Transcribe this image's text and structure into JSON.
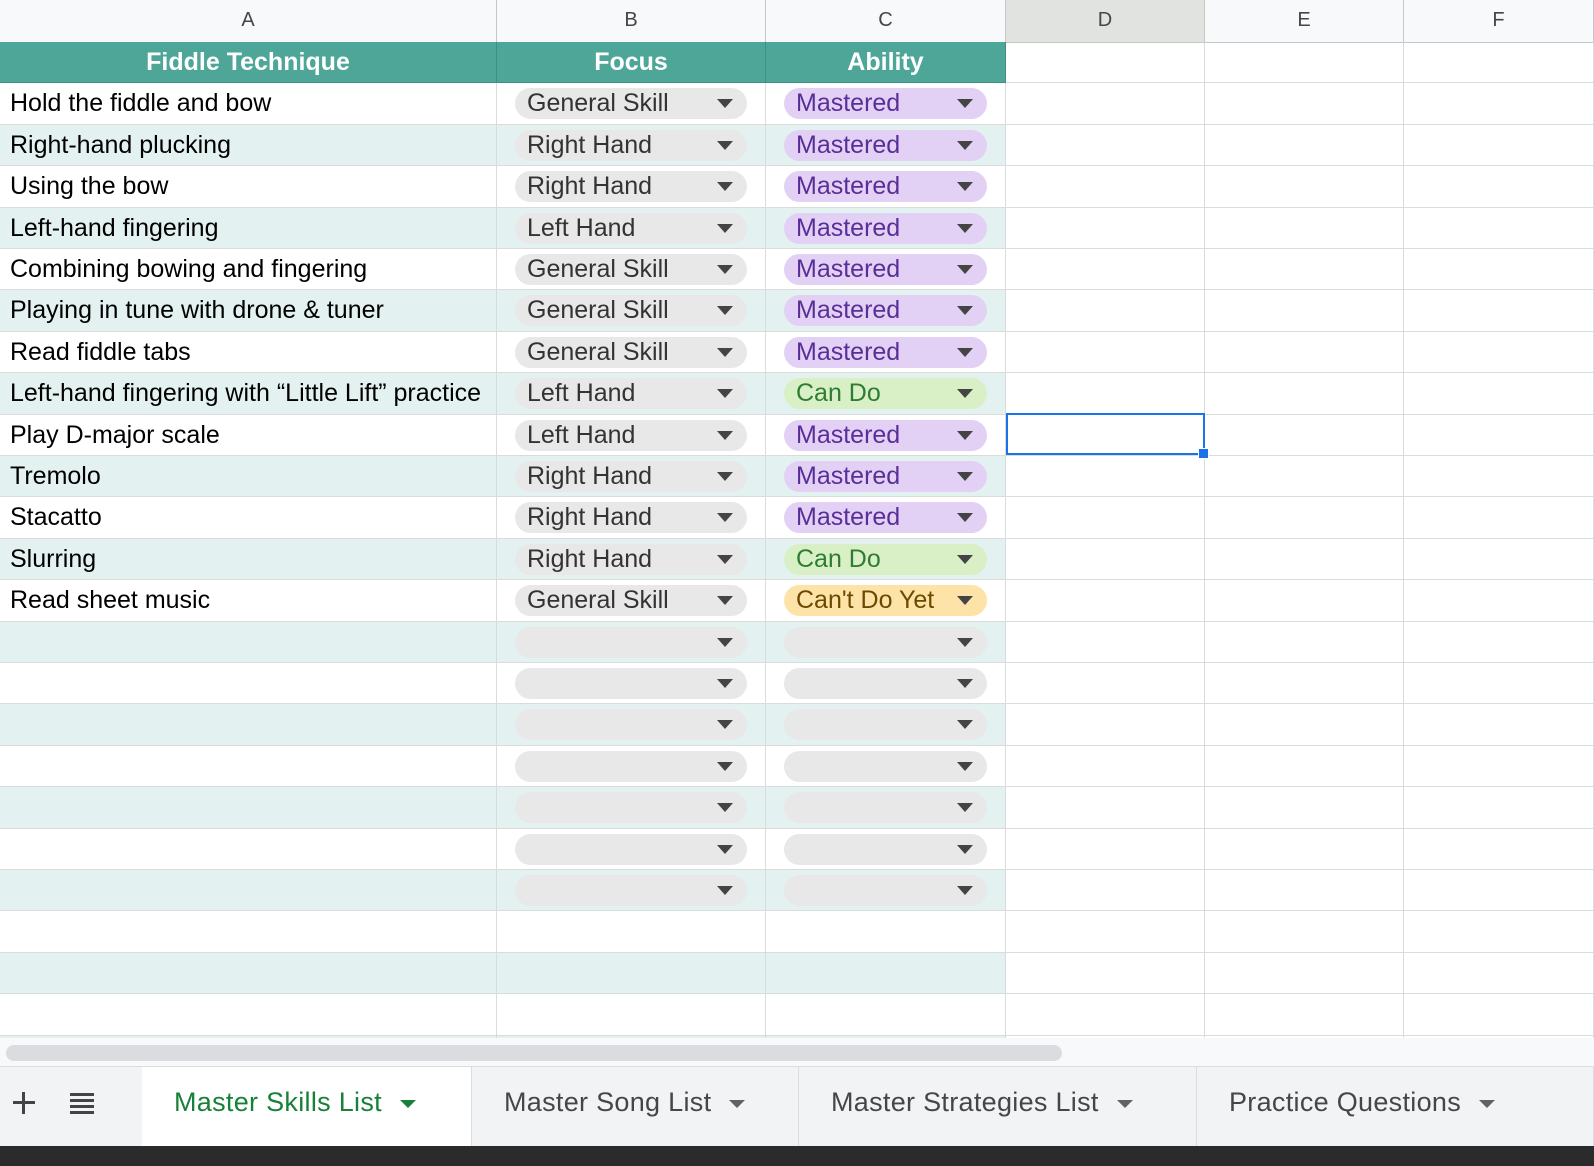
{
  "columns": [
    "A",
    "B",
    "C",
    "D",
    "E",
    "F"
  ],
  "headers": {
    "technique": "Fiddle Technique",
    "focus": "Focus",
    "ability": "Ability"
  },
  "rows": [
    {
      "technique": "Hold the fiddle and bow",
      "focus": "General Skill",
      "ability": "Mastered"
    },
    {
      "technique": "Right-hand plucking",
      "focus": "Right Hand",
      "ability": "Mastered"
    },
    {
      "technique": "Using the bow",
      "focus": "Right Hand",
      "ability": "Mastered"
    },
    {
      "technique": "Left-hand fingering",
      "focus": "Left Hand",
      "ability": "Mastered"
    },
    {
      "technique": "Combining bowing and fingering",
      "focus": "General Skill",
      "ability": "Mastered"
    },
    {
      "technique": "Playing in tune with drone & tuner",
      "focus": "General Skill",
      "ability": "Mastered"
    },
    {
      "technique": "Read fiddle tabs",
      "focus": "General Skill",
      "ability": "Mastered"
    },
    {
      "technique": "Left-hand fingering with “Little Lift” practice",
      "focus": "Left Hand",
      "ability": "Can Do"
    },
    {
      "technique": "Play D-major scale",
      "focus": "Left Hand",
      "ability": "Mastered"
    },
    {
      "technique": "Tremolo",
      "focus": "Right Hand",
      "ability": "Mastered"
    },
    {
      "technique": "Stacatto",
      "focus": "Right Hand",
      "ability": "Mastered"
    },
    {
      "technique": "Slurring",
      "focus": "Right Hand",
      "ability": "Can Do"
    },
    {
      "technique": "Read sheet music",
      "focus": "General Skill",
      "ability": "Can't Do Yet"
    }
  ],
  "empty_dropdown_rows": 7,
  "plain_rows": 3,
  "ability_colors": {
    "Mastered": {
      "bg": "#e2d1f5",
      "fg": "#5a2e98"
    },
    "Can Do": {
      "bg": "#d9f0c7",
      "fg": "#2e7d32"
    },
    "Can't Do Yet": {
      "bg": "#fde3a7",
      "fg": "#6b4a00"
    }
  },
  "theme": {
    "header_bg": "#4ea699",
    "band_bg": "#e3f2f0",
    "selection": "#1a73e8",
    "active_tab_text": "#188038"
  },
  "tabs": [
    {
      "label": "Master Skills List",
      "active": true
    },
    {
      "label": "Master Song List",
      "active": false
    },
    {
      "label": "Master Strategies List",
      "active": false
    },
    {
      "label": "Practice Questions",
      "active": false
    }
  ],
  "icons": {
    "add_sheet": "plus-icon",
    "all_sheets": "list-icon",
    "dropdown": "caret-down-icon"
  }
}
